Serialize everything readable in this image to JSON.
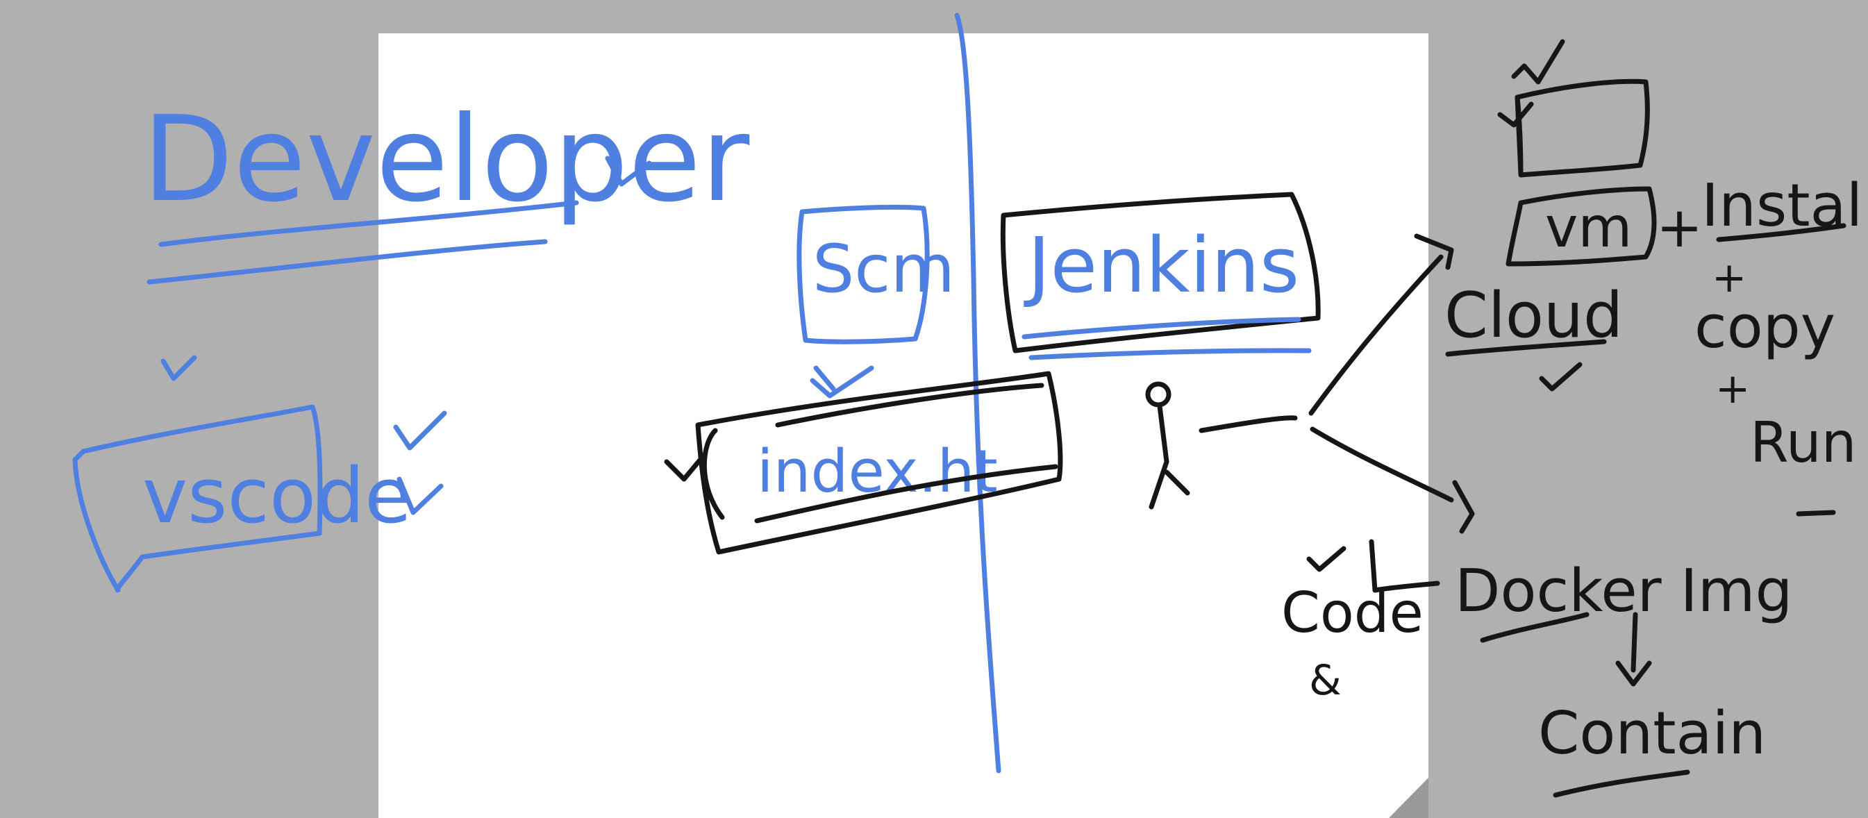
{
  "board": {
    "background_color": "#b0b0b0",
    "page_color": "#ffffff",
    "blue_ink_color": "#4f7fe0",
    "black_ink_color": "#161616"
  },
  "labels": {
    "developer": "Developer",
    "vscode": "vscode",
    "scm": "Scm",
    "jenkins": "Jenkins",
    "index": "index.ht",
    "vm": "vm",
    "install": "Install",
    "cloud": "Cloud",
    "copy": "copy",
    "run": "Run",
    "code": "Code",
    "and": "&",
    "docker_img": "Docker Img",
    "container": "Contain",
    "plus": "+"
  }
}
